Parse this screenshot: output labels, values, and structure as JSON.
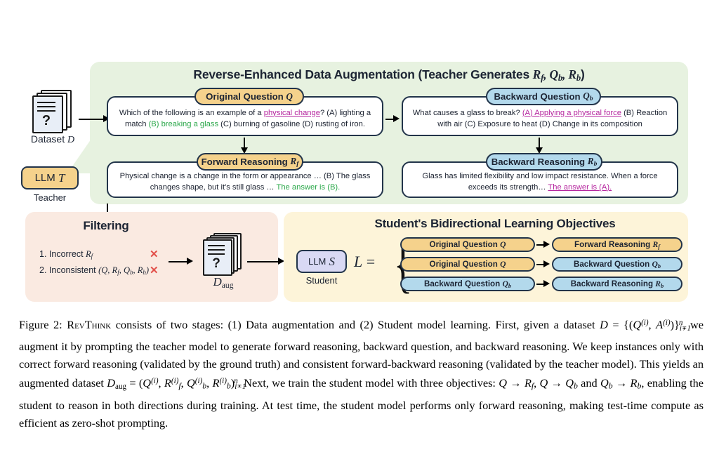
{
  "figure": {
    "augmentation": {
      "panel_title_main": "Reverse-Enhanced Data Augmentation (Teacher Generates ",
      "panel_title_math": "R_f, Q_b, R_b",
      "panel_title_close": ")",
      "dataset_icon_label": "Dataset",
      "dataset_icon_symbol": "D",
      "dataset_qmark": "?",
      "teacher_chip_label": "LLM",
      "teacher_chip_symbol": "T",
      "teacher_caption": "Teacher",
      "boxes": [
        {
          "id": "original-question",
          "pill_label": "Original Question",
          "pill_symbol": "Q",
          "pill_style": "orange",
          "text_segments": [
            {
              "t": "Which of the following is an example of a ",
              "style": "plain"
            },
            {
              "t": "physical change",
              "style": "purple"
            },
            {
              "t": "? (A) lighting a match ",
              "style": "plain"
            },
            {
              "t": "(B) breaking a glass",
              "style": "green"
            },
            {
              "t": " (C) burning of gasoline (D) rusting of iron.",
              "style": "plain"
            }
          ]
        },
        {
          "id": "backward-question",
          "pill_label": "Backward Question",
          "pill_symbol": "Q_b",
          "pill_style": "blue",
          "text_segments": [
            {
              "t": "What causes a glass to break? ",
              "style": "plain"
            },
            {
              "t": "(A) Applying a physical force",
              "style": "purple"
            },
            {
              "t": " (B) Reaction with air (C) Exposure to heat (D) Change in its composition",
              "style": "plain"
            }
          ]
        },
        {
          "id": "forward-reasoning",
          "pill_label": "Forward Reasoning",
          "pill_symbol": "R_f",
          "pill_style": "orange",
          "text_segments": [
            {
              "t": "Physical change is a change in the form or appearance … (B) The glass changes shape, but it's still glass … ",
              "style": "plain"
            },
            {
              "t": "The answer is (B).",
              "style": "green"
            }
          ]
        },
        {
          "id": "backward-reasoning",
          "pill_label": "Backward Reasoning",
          "pill_symbol": "R_b",
          "pill_style": "blue",
          "text_segments": [
            {
              "t": "Glass has limited flexibility and low impact resistance. When a force exceeds its strength… ",
              "style": "plain"
            },
            {
              "t": "The answer is (A).",
              "style": "purple"
            }
          ]
        }
      ]
    },
    "filtering": {
      "title": "Filtering",
      "items": [
        {
          "num": "1.",
          "label": "Incorrect ",
          "math": "R_f",
          "mark": "✕"
        },
        {
          "num": "2.",
          "label": "Inconsistent ",
          "math": "(Q, R_f, Q_b, R_b)",
          "mark": "✕"
        }
      ],
      "daug_label": "D",
      "daug_sub": "aug",
      "daug_qmark": "?"
    },
    "objectives": {
      "title": "Student's Bidirectional Learning Objectives",
      "student_chip_label": "LLM",
      "student_chip_symbol": "S",
      "student_caption": "Student",
      "loss_symbol": "L",
      "equals": "=",
      "rows": [
        {
          "source": {
            "label": "Original Question",
            "symbol": "Q",
            "style": "orange"
          },
          "target": {
            "label": "Forward Reasoning",
            "symbol": "R_f",
            "style": "orange"
          }
        },
        {
          "source": {
            "label": "Original Question",
            "symbol": "Q",
            "style": "orange"
          },
          "target": {
            "label": "Backward Question",
            "symbol": "Q_b",
            "style": "blue"
          }
        },
        {
          "source": {
            "label": "Backward Question",
            "symbol": "Q_b",
            "style": "blue"
          },
          "target": {
            "label": "Backward Reasoning",
            "symbol": "R_b",
            "style": "blue"
          }
        }
      ]
    },
    "caption": {
      "prefix": "Figure 2: ",
      "method_name": "RevThink",
      "body": " consists of two stages: (1) Data augmentation and (2) Student model learning. First, given a dataset D = {(Q(i), A(i))}n i=1, we augment it by prompting the teacher model to generate forward reasoning, backward question, and backward reasoning. We keep instances only with correct forward reasoning (validated by the ground truth) and consistent forward-backward reasoning (validated by the teacher model). This yields an augmented dataset Daug = (Q(i), Rf(i), Qb(i), Rb(i))n i=1. Next, we train the student model with three objectives: Q → Rf, Q → Qb and Qb → Rb, enabling the student to reason in both directions during training. At test time, the student model performs only forward reasoning, making test-time compute as efficient as zero-shot prompting."
    },
    "colors": {
      "green_panel": "#e7f2e0",
      "peach_panel": "#faeae1",
      "cream_panel": "#fdf4d9",
      "orange_pill": "#f5d28c",
      "blue_pill": "#b3d9ec",
      "lavender_chip": "#d9d9f4",
      "highlight_purple": "#b5259e",
      "highlight_green": "#2ba84a",
      "x_mark_red": "#e2504a",
      "outline": "#22344a"
    }
  }
}
